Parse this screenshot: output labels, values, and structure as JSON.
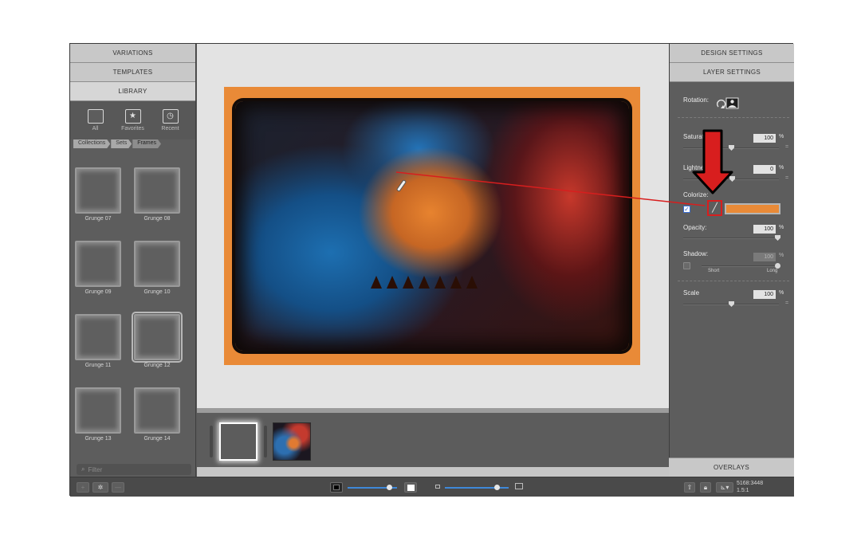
{
  "left_panel": {
    "tabs": [
      "VARIATIONS",
      "TEMPLATES",
      "LIBRARY"
    ],
    "library_filters": [
      {
        "label": "All",
        "icon": "square-icon"
      },
      {
        "label": "Favorites",
        "icon": "star-icon"
      },
      {
        "label": "Recent",
        "icon": "clock-icon"
      }
    ],
    "breadcrumb": [
      "Collections",
      "Sets",
      "Frames"
    ],
    "frames": [
      "Grunge 07",
      "Grunge 08",
      "Grunge 09",
      "Grunge 10",
      "Grunge 11",
      "Grunge 12",
      "Grunge 13",
      "Grunge 14"
    ],
    "selected_frame": "Grunge 12",
    "filter_placeholder": "Filter"
  },
  "right_panel": {
    "tabs": [
      "DESIGN SETTINGS",
      "LAYER SETTINGS"
    ],
    "rotation_label": "Rotation:",
    "saturation": {
      "label": "Saturat",
      "value": "100",
      "unit": "%"
    },
    "lightness": {
      "label": "Lightne",
      "value": "0",
      "unit": "%"
    },
    "colorize": {
      "label": "Colorize:",
      "checked": true,
      "color": "#e98a37"
    },
    "opacity": {
      "label": "Opacity:",
      "value": "100",
      "unit": "%"
    },
    "shadow": {
      "label": "Shadow:",
      "value": "100",
      "unit": "%",
      "short_label": "Short",
      "long_label": "Long",
      "checked": false
    },
    "scale": {
      "label": "Scale",
      "value": "100",
      "unit": "%"
    },
    "overlays": "OVERLAYS"
  },
  "bottom_bar": {
    "add": "+",
    "gear": "✲",
    "remove": "—",
    "dimensions": "5168:3448",
    "ratio": "1.5:1"
  },
  "colors": {
    "accent_orange": "#e98a37",
    "annotation_red": "#d81e1e",
    "slider_blue": "#3e88d8"
  }
}
